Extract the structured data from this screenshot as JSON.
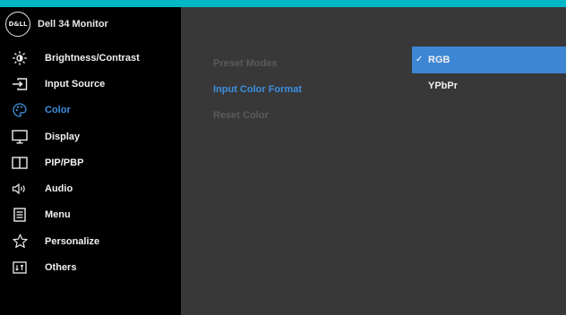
{
  "brand": {
    "title": "Dell 34 Monitor",
    "logo_text": "D&LL"
  },
  "menu": [
    {
      "label": "Brightness/Contrast",
      "icon": "brightness-icon"
    },
    {
      "label": "Input Source",
      "icon": "input-source-icon"
    },
    {
      "label": "Color",
      "icon": "color-palette-icon",
      "active": true
    },
    {
      "label": "Display",
      "icon": "display-icon"
    },
    {
      "label": "PIP/PBP",
      "icon": "pip-pbp-icon"
    },
    {
      "label": "Audio",
      "icon": "audio-icon"
    },
    {
      "label": "Menu",
      "icon": "menu-icon"
    },
    {
      "label": "Personalize",
      "icon": "star-icon"
    },
    {
      "label": "Others",
      "icon": "others-icon"
    }
  ],
  "color_submenu": [
    {
      "label": "Preset Modes",
      "state": "disabled"
    },
    {
      "label": "Input Color Format",
      "state": "active"
    },
    {
      "label": "Reset Color",
      "state": "disabled"
    }
  ],
  "input_color_format": {
    "options": [
      {
        "label": "RGB",
        "selected": true,
        "check": "✓"
      },
      {
        "label": "YPbPr",
        "selected": false
      }
    ]
  },
  "colors": {
    "accent": "#3d8fe0",
    "highlight": "#3d86d4",
    "panel": "#383838",
    "sidebar": "#000000",
    "frame": "#00b7c6"
  }
}
